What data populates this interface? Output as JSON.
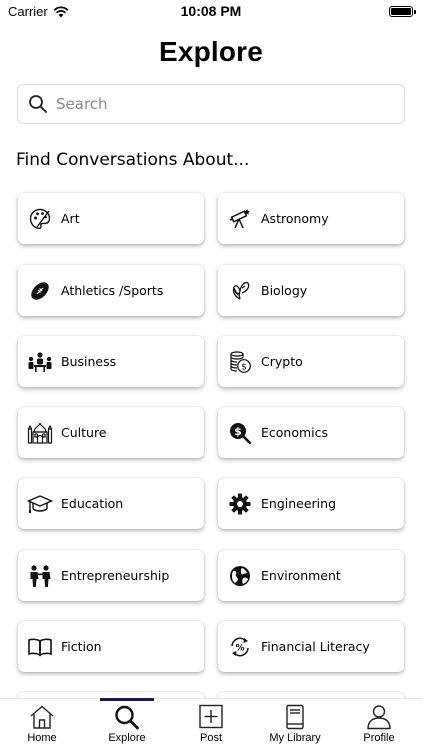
{
  "status": {
    "carrier": "Carrier",
    "time": "10:08 PM"
  },
  "header": {
    "title": "Explore"
  },
  "search": {
    "placeholder": "Search"
  },
  "section": {
    "title": "Find Conversations About..."
  },
  "categories": [
    {
      "label": "Art",
      "icon": "palette-icon"
    },
    {
      "label": "Astronomy",
      "icon": "telescope-icon"
    },
    {
      "label": "Athletics /Sports",
      "icon": "football-icon"
    },
    {
      "label": "Biology",
      "icon": "butterfly-icon"
    },
    {
      "label": "Business",
      "icon": "meeting-icon"
    },
    {
      "label": "Crypto",
      "icon": "coins-icon"
    },
    {
      "label": "Culture",
      "icon": "mosque-icon"
    },
    {
      "label": "Economics",
      "icon": "dollar-search-icon"
    },
    {
      "label": "Education",
      "icon": "graduation-cap-icon"
    },
    {
      "label": "Engineering",
      "icon": "gear-icon"
    },
    {
      "label": "Entrepreneurship",
      "icon": "people-icon"
    },
    {
      "label": "Environment",
      "icon": "globe-icon"
    },
    {
      "label": "Fiction",
      "icon": "book-icon"
    },
    {
      "label": "Financial Literacy",
      "icon": "percent-cycle-icon"
    }
  ],
  "tabs": [
    {
      "label": "Home",
      "icon": "home-icon"
    },
    {
      "label": "Explore",
      "icon": "search-icon",
      "active": true
    },
    {
      "label": "Post",
      "icon": "plus-square-icon"
    },
    {
      "label": "My Library",
      "icon": "library-book-icon"
    },
    {
      "label": "Profile",
      "icon": "person-icon"
    }
  ],
  "colors": {
    "accent": "#1e1a4d"
  }
}
